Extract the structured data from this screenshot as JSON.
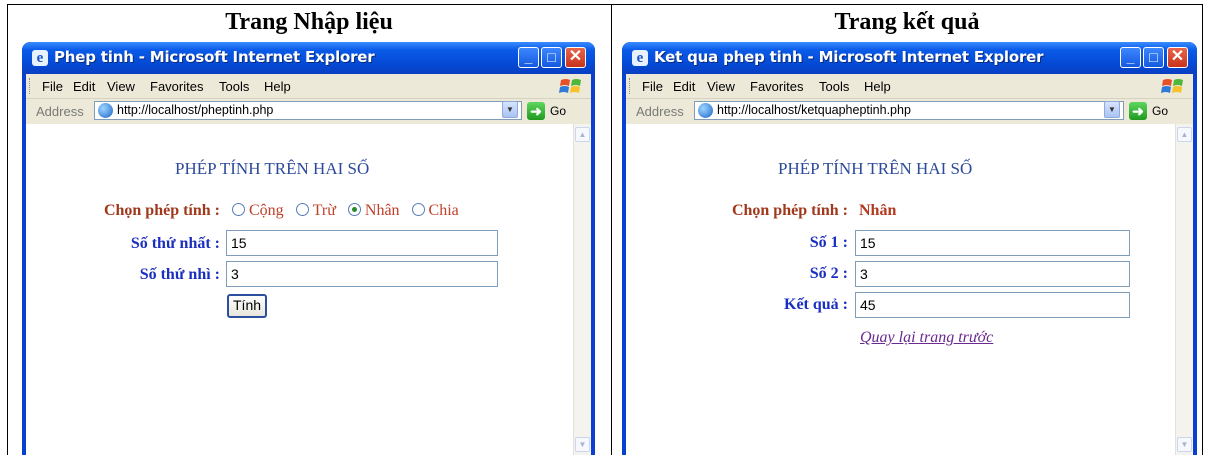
{
  "captions": {
    "left": "Trang Nhập liệu",
    "right": "Trang kết quả"
  },
  "left_window": {
    "title": "Phep tinh - Microsoft Internet Explorer",
    "menu": [
      "File",
      "Edit",
      "View",
      "Favorites",
      "Tools",
      "Help"
    ],
    "address_label": "Address",
    "url": "http://localhost/pheptinh.php",
    "go_label": "Go",
    "page": {
      "heading": "PHÉP TÍNH TRÊN HAI SỐ",
      "operation_label": "Chọn phép tính :",
      "options": [
        "Cộng",
        "Trừ",
        "Nhân",
        "Chia"
      ],
      "selected_option": "Nhân",
      "first_label": "Số thứ nhất :",
      "first_value": "15",
      "second_label": "Số thứ nhì :",
      "second_value": "3",
      "submit_label": "Tính"
    }
  },
  "right_window": {
    "title": "Ket qua phep tinh - Microsoft Internet Explorer",
    "menu": [
      "File",
      "Edit",
      "View",
      "Favorites",
      "Tools",
      "Help"
    ],
    "address_label": "Address",
    "url": "http://localhost/ketquapheptinh.php",
    "go_label": "Go",
    "page": {
      "heading": "PHÉP TÍNH TRÊN HAI SỐ",
      "operation_label": "Chọn phép tính :",
      "operation_value": "Nhân",
      "num1_label": "Số 1 :",
      "num1_value": "15",
      "num2_label": "Số 2 :",
      "num2_value": "3",
      "result_label": "Kết quả :",
      "result_value": "45",
      "back_link": "Quay lại trang trước"
    }
  }
}
